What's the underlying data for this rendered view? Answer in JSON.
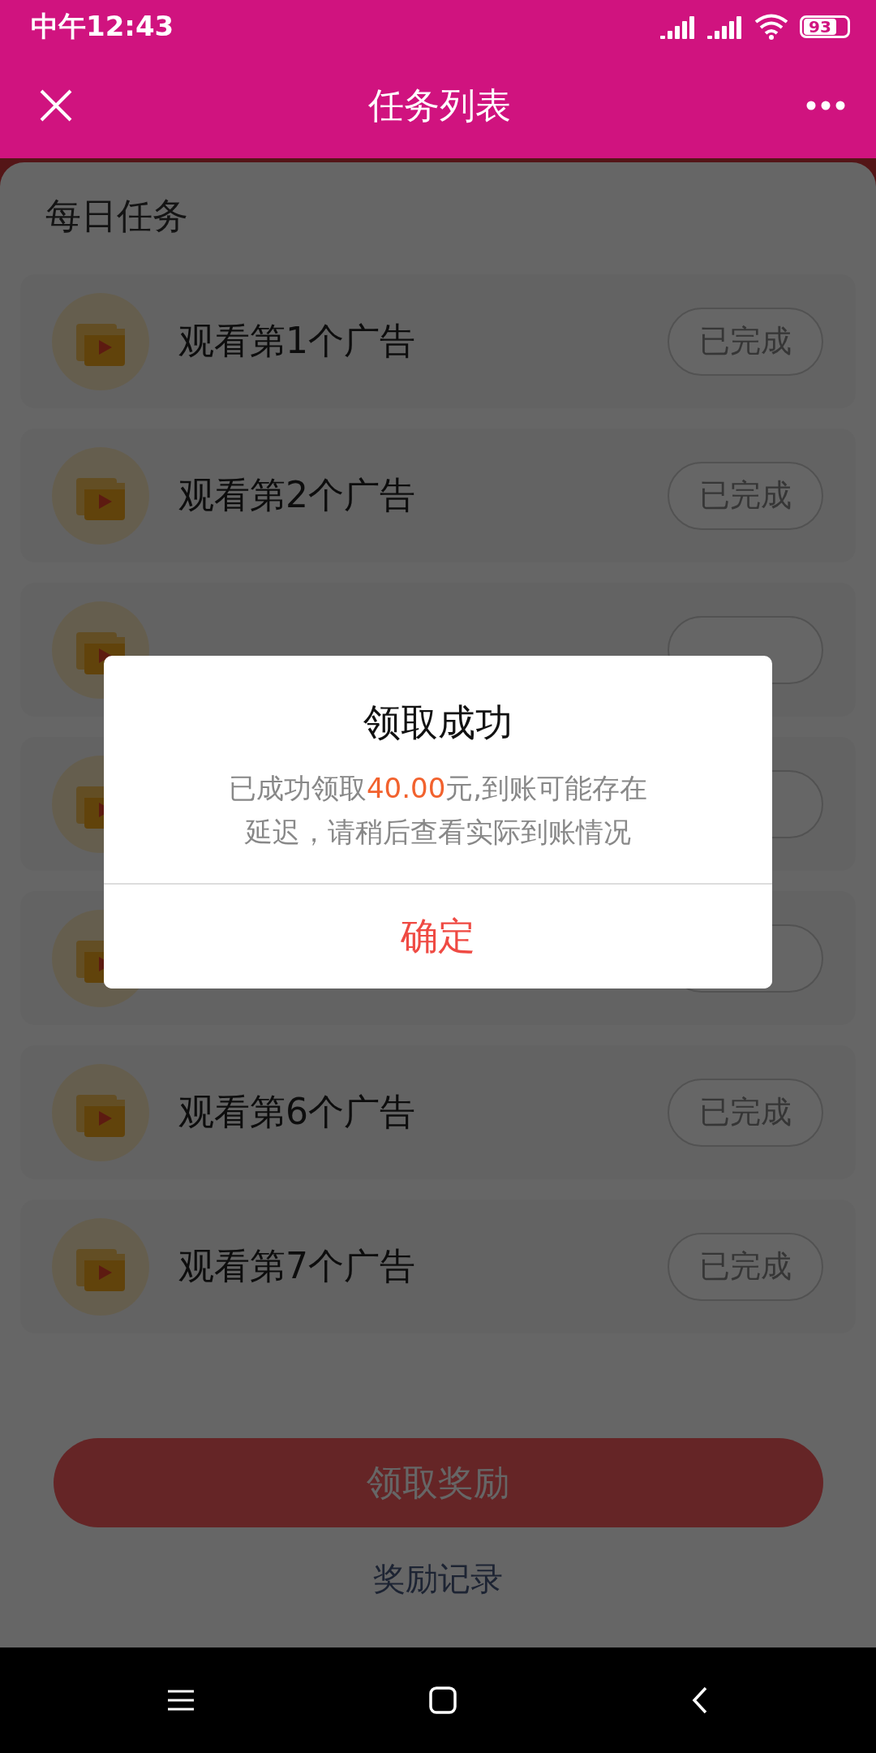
{
  "status_bar": {
    "time": "中午12:43",
    "battery": "93"
  },
  "header": {
    "title": "任务列表"
  },
  "section_title": "每日任务",
  "tasks": [
    {
      "kind": "task",
      "label": "观看第1个广告",
      "status": "已完成"
    },
    {
      "kind": "task",
      "label": "观看第2个广告",
      "status": "已完成"
    },
    {
      "kind": "covered"
    },
    {
      "kind": "covered"
    },
    {
      "kind": "covered"
    },
    {
      "kind": "task",
      "label": "观看第6个广告",
      "status": "已完成"
    },
    {
      "kind": "task",
      "label": "观看第7个广告",
      "status": "已完成"
    }
  ],
  "claim_button": "领取奖励",
  "records_link": "奖励记录",
  "dialog": {
    "title": "领取成功",
    "message_prefix": "已成功领取",
    "amount": "40.00",
    "message_suffix": "元,到账可能存在延迟，请稍后查看实际到账情况",
    "confirm": "确定"
  }
}
